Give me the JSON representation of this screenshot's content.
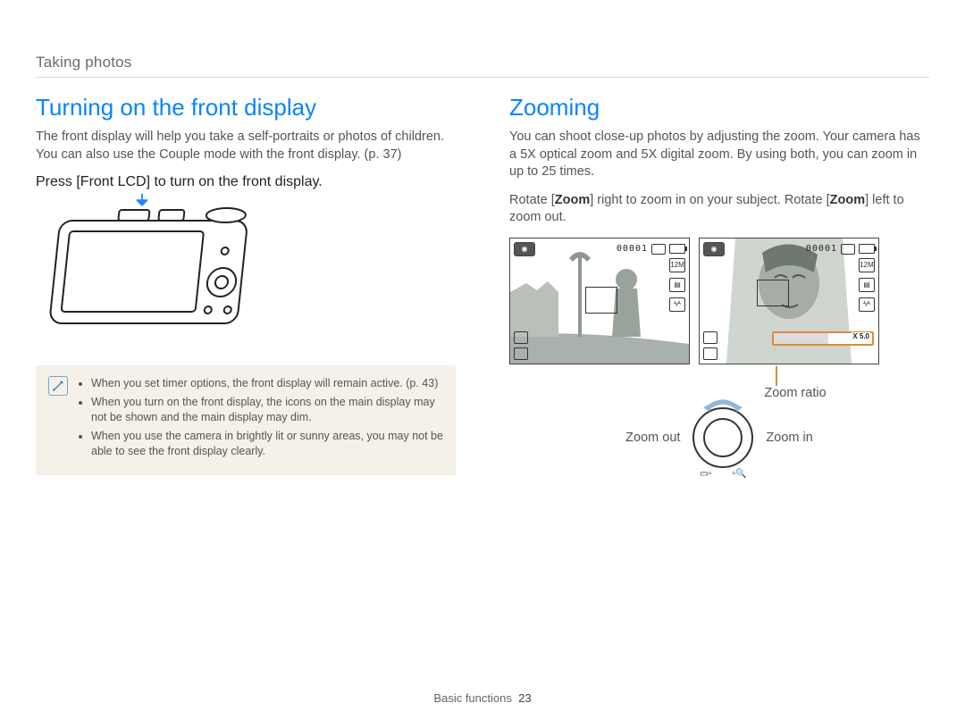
{
  "breadcrumb": "Taking photos",
  "left": {
    "heading": "Turning on the front display",
    "intro": "The front display will help you take a self-portraits or photos of children. You can also use the Couple mode with the front display. (p. 37)",
    "step": "Press [Front LCD] to turn on the front display.",
    "notes": [
      "When you set timer options, the front display will remain active. (p. 43)",
      "When you turn on the front display, the icons on the main display may not be shown and the main display may dim.",
      "When you use the camera in brightly lit or sunny areas, you may not be able to see the front display clearly."
    ]
  },
  "right": {
    "heading": "Zooming",
    "intro": "You can shoot close-up photos by adjusting the zoom. Your camera has a 5X optical zoom and 5X digital zoom. By using both, you can zoom in up to 25 times.",
    "rotate_pre": "Rotate [",
    "rotate_zoom1": "Zoom",
    "rotate_mid": "] right to zoom in on your subject. Rotate [",
    "rotate_zoom2": "Zoom",
    "rotate_post": "] left to zoom out.",
    "lcd": {
      "counter": "00001",
      "res_label": "12M",
      "zoom_value_label": "X 5.0"
    },
    "zoom_ratio_label": "Zoom ratio",
    "zoom_out_label": "Zoom out",
    "zoom_in_label": "Zoom in"
  },
  "footer": {
    "section": "Basic functions",
    "page": "23"
  }
}
